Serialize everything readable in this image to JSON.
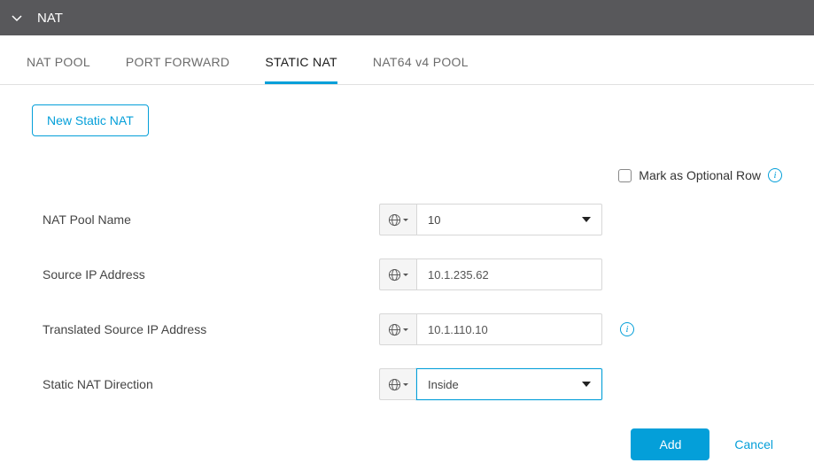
{
  "header": {
    "title": "NAT"
  },
  "tabs": [
    {
      "label": "NAT POOL",
      "active": false
    },
    {
      "label": "PORT FORWARD",
      "active": false
    },
    {
      "label": "STATIC NAT",
      "active": true
    },
    {
      "label": "NAT64 v4 POOL",
      "active": false
    }
  ],
  "actions": {
    "new_static_nat": "New Static NAT",
    "add": "Add",
    "cancel": "Cancel"
  },
  "optional": {
    "label": "Mark as Optional Row"
  },
  "form": {
    "nat_pool_name": {
      "label": "NAT Pool Name",
      "value": "10"
    },
    "source_ip": {
      "label": "Source IP Address",
      "value": "10.1.235.62"
    },
    "translated_source_ip": {
      "label": "Translated Source IP Address",
      "value": "10.1.110.10"
    },
    "static_nat_direction": {
      "label": "Static NAT Direction",
      "value": "Inside"
    }
  }
}
